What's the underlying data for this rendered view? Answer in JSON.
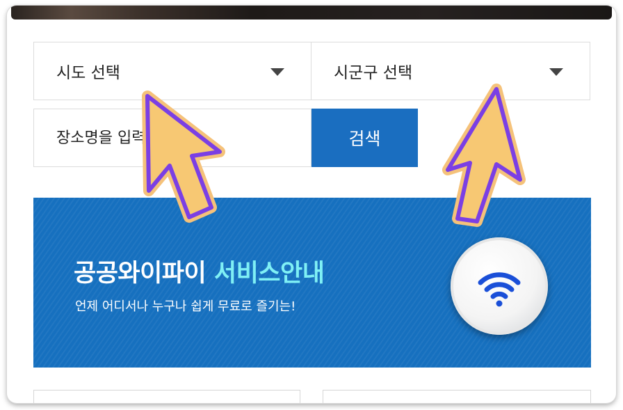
{
  "filters": {
    "sido_label": "시도 선택",
    "sigungu_label": "시군구 선택"
  },
  "search": {
    "placeholder": "장소명을 입력하세요.",
    "button_label": "검색"
  },
  "banner": {
    "title_main": "공공와이파이 ",
    "title_accent": "서비스안내",
    "subtitle": "언제 어디서나 누구나 쉽게 무료로 즐기는!",
    "icon": "wifi-icon"
  },
  "colors": {
    "primary_blue": "#1a6ec0",
    "accent_cyan": "#7ff0f5",
    "cursor_fill": "#f7c873",
    "cursor_outline": "#7b3fe4"
  },
  "overlay": {
    "cursor_icon": "arrow-cursor-icon"
  }
}
